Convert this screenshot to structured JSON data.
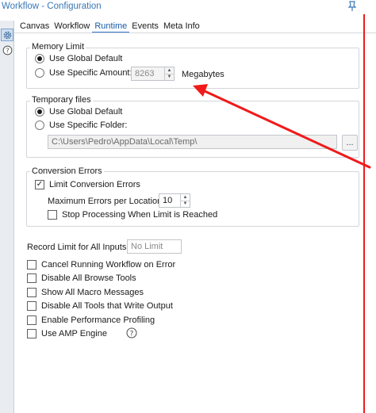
{
  "window": {
    "title": "Workflow - Configuration"
  },
  "tabs": [
    {
      "label": "Canvas"
    },
    {
      "label": "Workflow"
    },
    {
      "label": "Runtime"
    },
    {
      "label": "Events"
    },
    {
      "label": "Meta Info"
    }
  ],
  "memory_limit": {
    "label": "Memory Limit",
    "global_default": "Use Global Default",
    "specific_amount": "Use Specific Amount:",
    "amount_value": "8263",
    "unit": "Megabytes"
  },
  "temporary_files": {
    "label": "Temporary files",
    "global_default": "Use Global Default",
    "specific_folder": "Use Specific Folder:",
    "folder_path": "C:\\Users\\Pedro\\AppData\\Local\\Temp\\",
    "browse_label": "..."
  },
  "conversion_errors": {
    "label": "Conversion Errors",
    "limit_label": "Limit Conversion Errors",
    "max_errors_label": "Maximum Errors per Location:",
    "max_errors_value": "10",
    "stop_label": "Stop Processing When Limit is Reached"
  },
  "record_limit": {
    "label": "Record Limit for All Inputs:",
    "placeholder": "No Limit"
  },
  "options": [
    {
      "label": "Cancel Running Workflow on Error"
    },
    {
      "label": "Disable All Browse Tools"
    },
    {
      "label": "Show All Macro Messages"
    },
    {
      "label": "Disable All Tools that Write Output"
    },
    {
      "label": "Enable Performance Profiling"
    },
    {
      "label": "Use AMP Engine"
    }
  ],
  "colors": {
    "title": "#3a78b5",
    "active_tab": "#1a5aa8",
    "annotation": "#f01a1a"
  }
}
